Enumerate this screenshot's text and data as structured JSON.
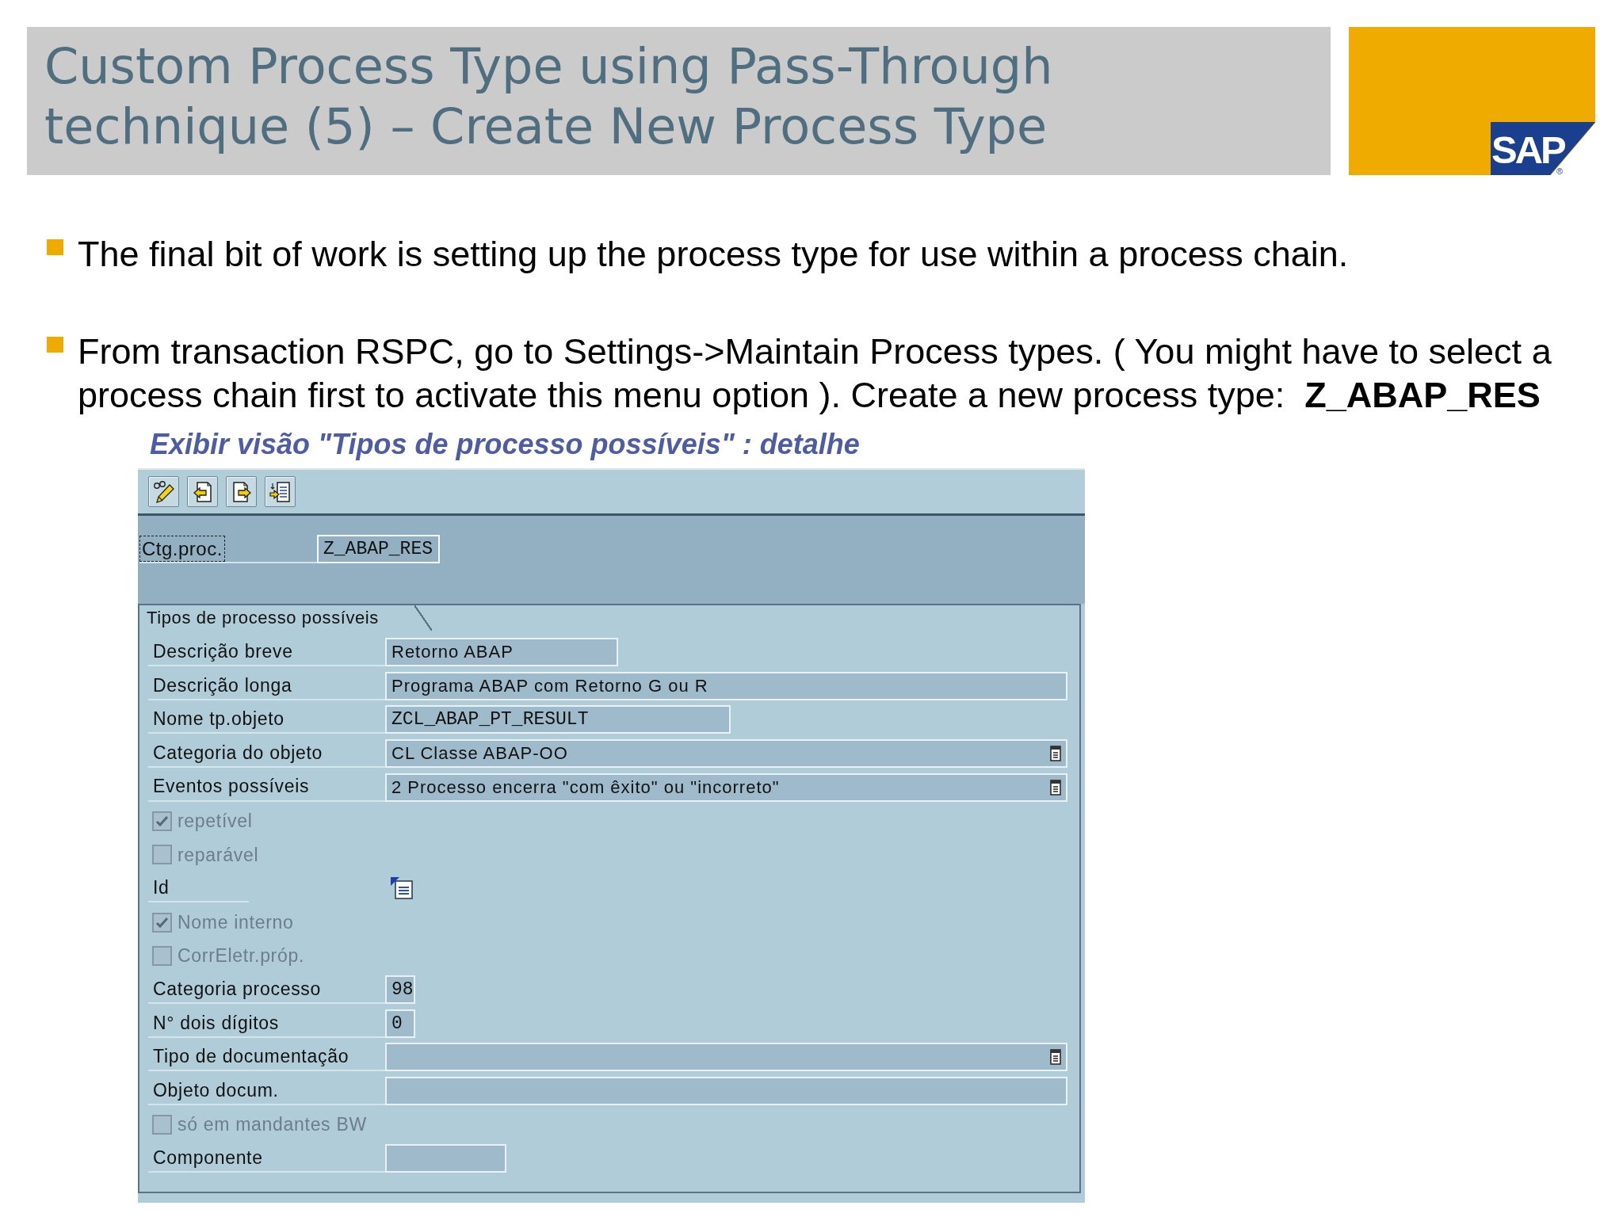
{
  "slide": {
    "title_lines": [
      "Custom Process Type using Pass-Through",
      "technique (5) – Create New Process Type"
    ]
  },
  "logo": {
    "text": "SAP",
    "registered": "®"
  },
  "bullets": [
    "The final bit of work is setting up the process type for use within a process chain.",
    "From transaction RSPC, go to Settings->Maintain Process types. ( You might have to select a process chain first to activate this menu option ). Create a new process type:  **Z_ABAP_RES**"
  ],
  "screen": {
    "title": "Exibir visão \"Tipos de processo possíveis\" : detalhe",
    "key_field": {
      "label": "Ctg.proc.",
      "value": "Z_ABAP_RES"
    },
    "group": {
      "title": "Tipos de processo possíveis",
      "rows": [
        {
          "kind": "field",
          "label": "Descrição breve",
          "value": "Retorno ABAP"
        },
        {
          "kind": "field",
          "label": "Descrição longa",
          "value": "Programa ABAP com Retorno G ou R"
        },
        {
          "kind": "field",
          "label": "Nome tp.objeto",
          "value": "ZCL_ABAP_PT_RESULT"
        },
        {
          "kind": "dropdown",
          "label": "Categoria do objeto",
          "value": "CL Classe ABAP-OO"
        },
        {
          "kind": "dropdown",
          "label": "Eventos possíveis",
          "value": "2 Processo encerra \"com êxito\" ou \"incorreto\""
        },
        {
          "kind": "checkbox",
          "label": "repetível",
          "checked": true,
          "disabled": true
        },
        {
          "kind": "checkbox",
          "label": "reparável",
          "checked": false,
          "disabled": true
        },
        {
          "kind": "icon",
          "label": "Id"
        },
        {
          "kind": "checkbox",
          "label": "Nome interno",
          "checked": true,
          "disabled": true
        },
        {
          "kind": "checkbox",
          "label": "CorrEletr.próp.",
          "checked": false,
          "disabled": true
        },
        {
          "kind": "field",
          "label": "Categoria processo",
          "value": "98"
        },
        {
          "kind": "field",
          "label": "N° dois dígitos",
          "value": "0"
        },
        {
          "kind": "dropdown",
          "label": "Tipo de documentação"
        },
        {
          "kind": "field",
          "label": "Objeto docum."
        },
        {
          "kind": "checkbox",
          "label": "só em mandantes BW",
          "checked": false,
          "disabled": true
        },
        {
          "kind": "field",
          "label": "Componente"
        }
      ]
    }
  }
}
